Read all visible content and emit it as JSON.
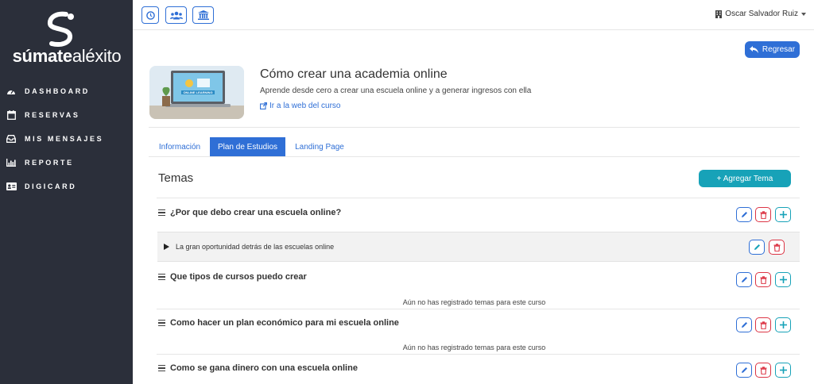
{
  "sidebar": {
    "brand_bold": "súmate",
    "brand_light": "aléxito",
    "items": [
      {
        "label": "DASHBOARD",
        "icon": "dashboard-gauge-icon"
      },
      {
        "label": "RESERVAS",
        "icon": "calendar-icon"
      },
      {
        "label": "MIS MENSAJES",
        "icon": "inbox-icon"
      },
      {
        "label": "REPORTE",
        "icon": "bar-chart-icon"
      },
      {
        "label": "DIGICARD",
        "icon": "id-card-icon"
      }
    ]
  },
  "topbar": {
    "icons": [
      "clock-icon",
      "users-icon",
      "institution-icon"
    ],
    "user_name": "Oscar Salvador Ruiz"
  },
  "back_button": {
    "label": "Regresar"
  },
  "course": {
    "title": "Cómo crear una academia online",
    "subtitle": "Aprende desde cero a crear una escuela online y a generar ingresos con ella",
    "link_label": "Ir a la web del curso",
    "thumbnail_text": "ONLINE LEARNING"
  },
  "tabs": [
    {
      "label": "Información",
      "active": false
    },
    {
      "label": "Plan de Estudios",
      "active": true
    },
    {
      "label": "Landing Page",
      "active": false
    }
  ],
  "section": {
    "title": "Temas",
    "add_button": "+ Agregar Tema"
  },
  "topics": [
    {
      "title": "¿Por que debo crear una escuela online?",
      "lessons": [
        "La gran oportunidad detrás de las escuelas online"
      ],
      "empty_message": ""
    },
    {
      "title": "Que tipos de cursos puedo crear",
      "lessons": [],
      "empty_message": "Aún no has registrado temas para este curso"
    },
    {
      "title": "Como hacer un plan económico para mi escuela online",
      "lessons": [],
      "empty_message": "Aún no has registrado temas para este curso"
    },
    {
      "title": "Como se gana dinero con una escuela online",
      "lessons": [],
      "empty_message": ""
    }
  ],
  "colors": {
    "sidebar_bg": "#2b2f3a",
    "primary": "#2f6fd6",
    "teal": "#17a2b8",
    "danger": "#dc3545"
  }
}
